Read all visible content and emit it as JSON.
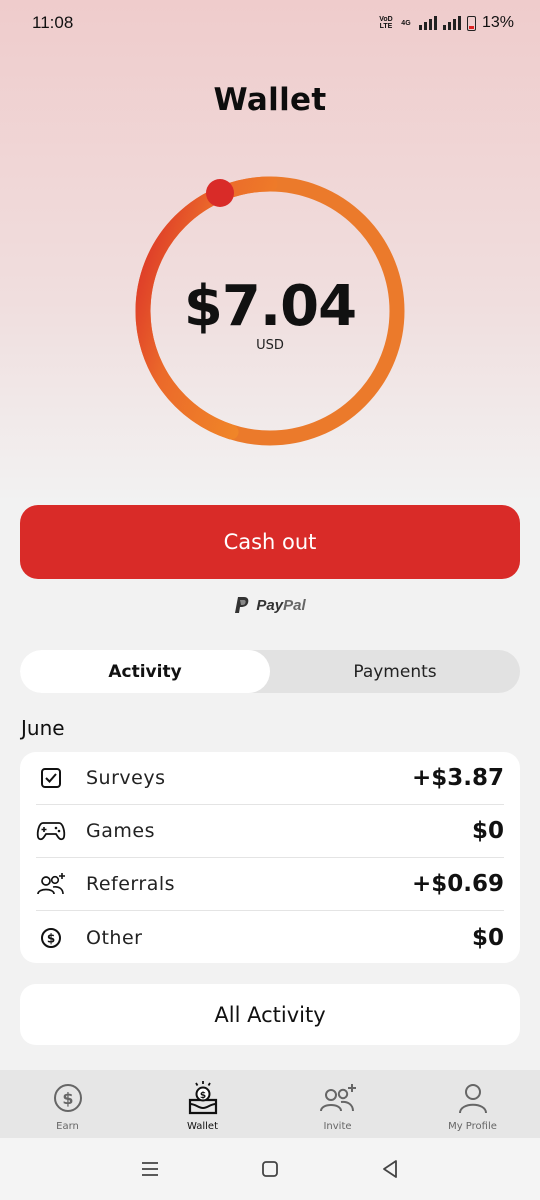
{
  "status_bar": {
    "time": "11:08",
    "net_label": "VoD LTE",
    "net_type": "4G",
    "battery": "13%"
  },
  "header": {
    "title": "Wallet"
  },
  "balance": {
    "amount": "$7.04",
    "currency": "USD",
    "ring_progress": 0.98
  },
  "colors": {
    "accent": "#d92b28",
    "ring_start": "#d92b28",
    "ring_end": "#f08628"
  },
  "cashout": {
    "label": "Cash out",
    "provider": {
      "part1": "Pay",
      "part2": "Pal"
    }
  },
  "tabs": [
    {
      "label": "Activity",
      "active": true
    },
    {
      "label": "Payments",
      "active": false
    }
  ],
  "activity": {
    "month": "June",
    "items": [
      {
        "icon": "checkbox-icon",
        "label": "Surveys",
        "value": "+$3.87"
      },
      {
        "icon": "gamepad-icon",
        "label": "Games",
        "value": "$0"
      },
      {
        "icon": "referrals-icon",
        "label": "Referrals",
        "value": "+$0.69"
      },
      {
        "icon": "dollar-circle-icon",
        "label": "Other",
        "value": "$0"
      }
    ],
    "all_label": "All Activity"
  },
  "bottom_nav": [
    {
      "icon": "dollar-circle-icon",
      "label": "Earn",
      "active": false
    },
    {
      "icon": "wallet-icon",
      "label": "Wallet",
      "active": true
    },
    {
      "icon": "invite-icon",
      "label": "Invite",
      "active": false
    },
    {
      "icon": "profile-icon",
      "label": "My Profile",
      "active": false
    }
  ]
}
